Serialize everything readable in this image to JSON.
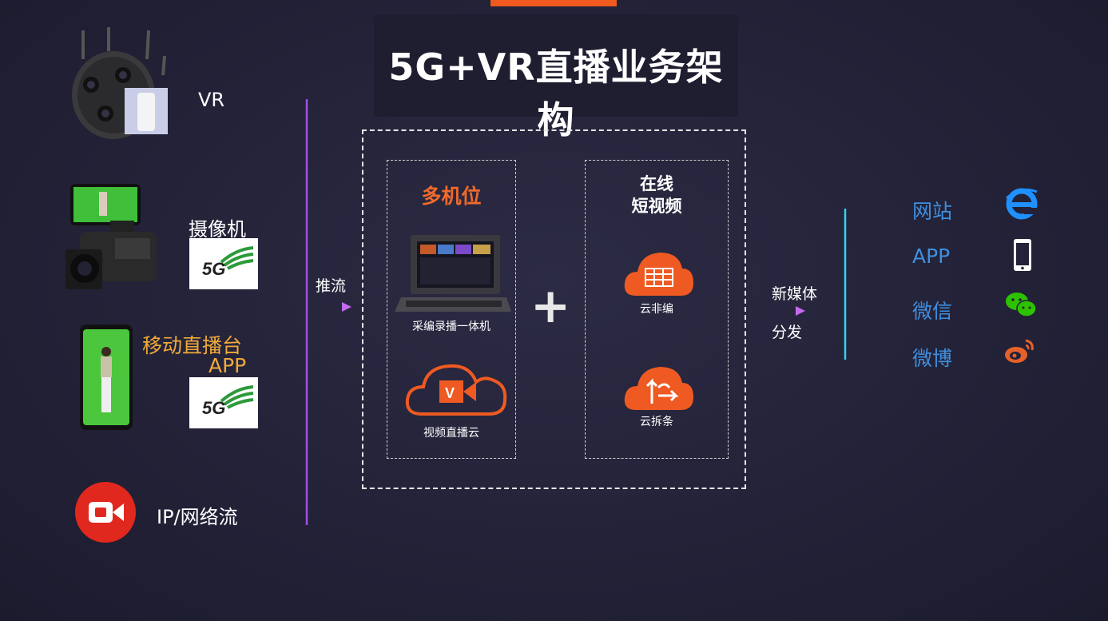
{
  "title": "5G+VR直播业务架构",
  "sources": {
    "vr": "VR",
    "camera": "摄像机",
    "mobile_line1": "移动直播台",
    "mobile_line2": "APP",
    "ip": "IP/网络流",
    "badge_5g": "5G"
  },
  "push_label": "推流",
  "box_left": {
    "title": "多机位",
    "item1": "采编录播一体机",
    "item2": "视频直播云",
    "logo_letter": "V"
  },
  "plus": "+",
  "box_right": {
    "title_line1": "在线",
    "title_line2": "短视频",
    "item1": "云非编",
    "item2": "云拆条"
  },
  "distribute": {
    "line1": "新媒体",
    "line2": "分发"
  },
  "outputs": [
    {
      "label": "网站",
      "icon": "ie-icon"
    },
    {
      "label": "APP",
      "icon": "phone-icon"
    },
    {
      "label": "微信",
      "icon": "wechat-icon"
    },
    {
      "label": "微博",
      "icon": "weibo-icon"
    }
  ],
  "colors": {
    "accent": "#f05a1e",
    "orange_text": "#f0a93a",
    "blue_text": "#3f8fe0",
    "bracket_purple": "#a24fe6",
    "bracket_cyan": "#2fd3f0"
  }
}
